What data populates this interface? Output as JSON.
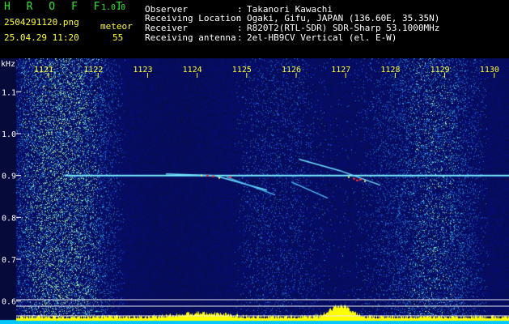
{
  "app": {
    "title": "H R O F F T",
    "version": "1.0.0"
  },
  "file": {
    "name": "2504291120.png",
    "datetime": "25.04.29 11:20"
  },
  "meteor": {
    "label": "meteor",
    "count": "55"
  },
  "info": [
    {
      "label": "Observer",
      "sep": ":",
      "value": "Takanori Kawachi"
    },
    {
      "label": "Receiving Location",
      "sep": ":",
      "value": "Ogaki, Gifu, JAPAN (136.60E, 35.35N)"
    },
    {
      "label": "Receiver",
      "sep": ":",
      "value": "R820T2(RTL-SDR) SDR-Sharp 53.1000MHz"
    },
    {
      "label": "Receiving antenna",
      "sep": ":",
      "value": "2el-HB9CV Vertical (el. E-W)"
    }
  ],
  "axis": {
    "y_unit": "kHz",
    "x_ticks": [
      "1121",
      "1122",
      "1123",
      "1124",
      "1125",
      "1126",
      "1127",
      "1128",
      "1129",
      "1130"
    ],
    "y_ticks": [
      "1.1",
      "1.0",
      "0.9",
      "0.8",
      "0.7",
      "0.6"
    ],
    "y_range_khz": [
      0.58,
      1.18
    ]
  },
  "colors": {
    "background": "#050a3a",
    "carrier": "#39d6ff",
    "meteor_hot": "#ff3030",
    "level_bar": "#ffff00",
    "level_base": "#00c8ff"
  }
}
